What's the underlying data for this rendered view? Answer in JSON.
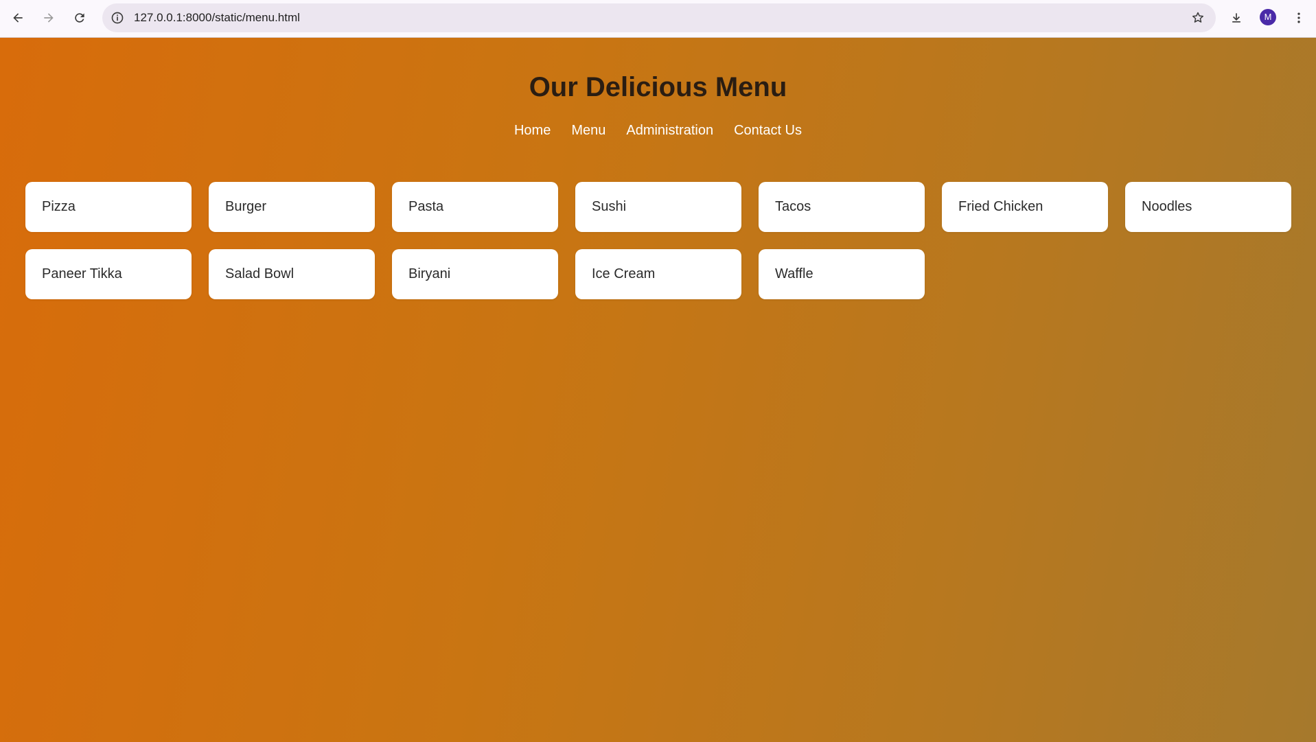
{
  "browser": {
    "url": "127.0.0.1:8000/static/menu.html",
    "profile_initial": "M"
  },
  "page": {
    "title": "Our Delicious Menu",
    "nav": [
      {
        "label": "Home"
      },
      {
        "label": "Menu"
      },
      {
        "label": "Administration"
      },
      {
        "label": "Contact Us"
      }
    ],
    "items": [
      {
        "name": "Pizza"
      },
      {
        "name": "Burger"
      },
      {
        "name": "Pasta"
      },
      {
        "name": "Sushi"
      },
      {
        "name": "Tacos"
      },
      {
        "name": "Fried Chicken"
      },
      {
        "name": "Noodles"
      },
      {
        "name": "Paneer Tikka"
      },
      {
        "name": "Salad Bowl"
      },
      {
        "name": "Biryani"
      },
      {
        "name": "Ice Cream"
      },
      {
        "name": "Waffle"
      }
    ]
  },
  "colors": {
    "gradient_start": "#d86c0b",
    "gradient_end": "#a6792c",
    "title": "#2a1d12",
    "card": "#ffffff"
  }
}
